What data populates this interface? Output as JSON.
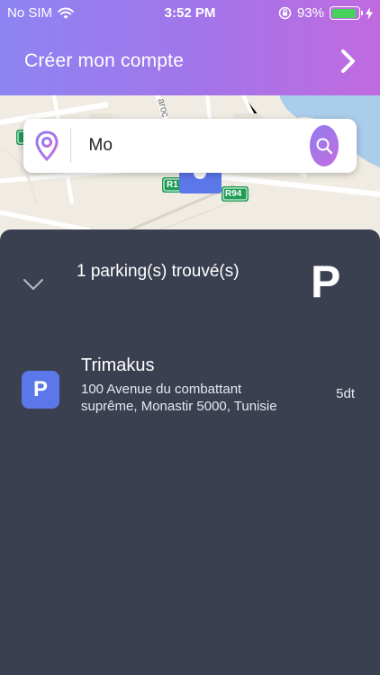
{
  "status_bar": {
    "carrier": "No SIM",
    "time": "3:52 PM",
    "battery": "93%",
    "battery_level": 0.93
  },
  "header": {
    "create_account": "Créer mon compte"
  },
  "map": {
    "road_labels": [
      "R1",
      "R94"
    ],
    "street_fragment": "aroc"
  },
  "search": {
    "value": "Mo"
  },
  "results": {
    "count_text": "1 parking(s) trouvé(s)",
    "badge_letter": "P"
  },
  "parkings": [
    {
      "icon_letter": "P",
      "name": "Trimakus",
      "address": "100 Avenue du combattant suprême, Monastir 5000, Tunisie",
      "price": "5dt"
    }
  ],
  "colors": {
    "gradient_start": "#8e84f2",
    "gradient_end": "#c06adf",
    "panel": "#3b4050",
    "parking_icon": "#5c77ea",
    "accent": "#9a65e8"
  }
}
